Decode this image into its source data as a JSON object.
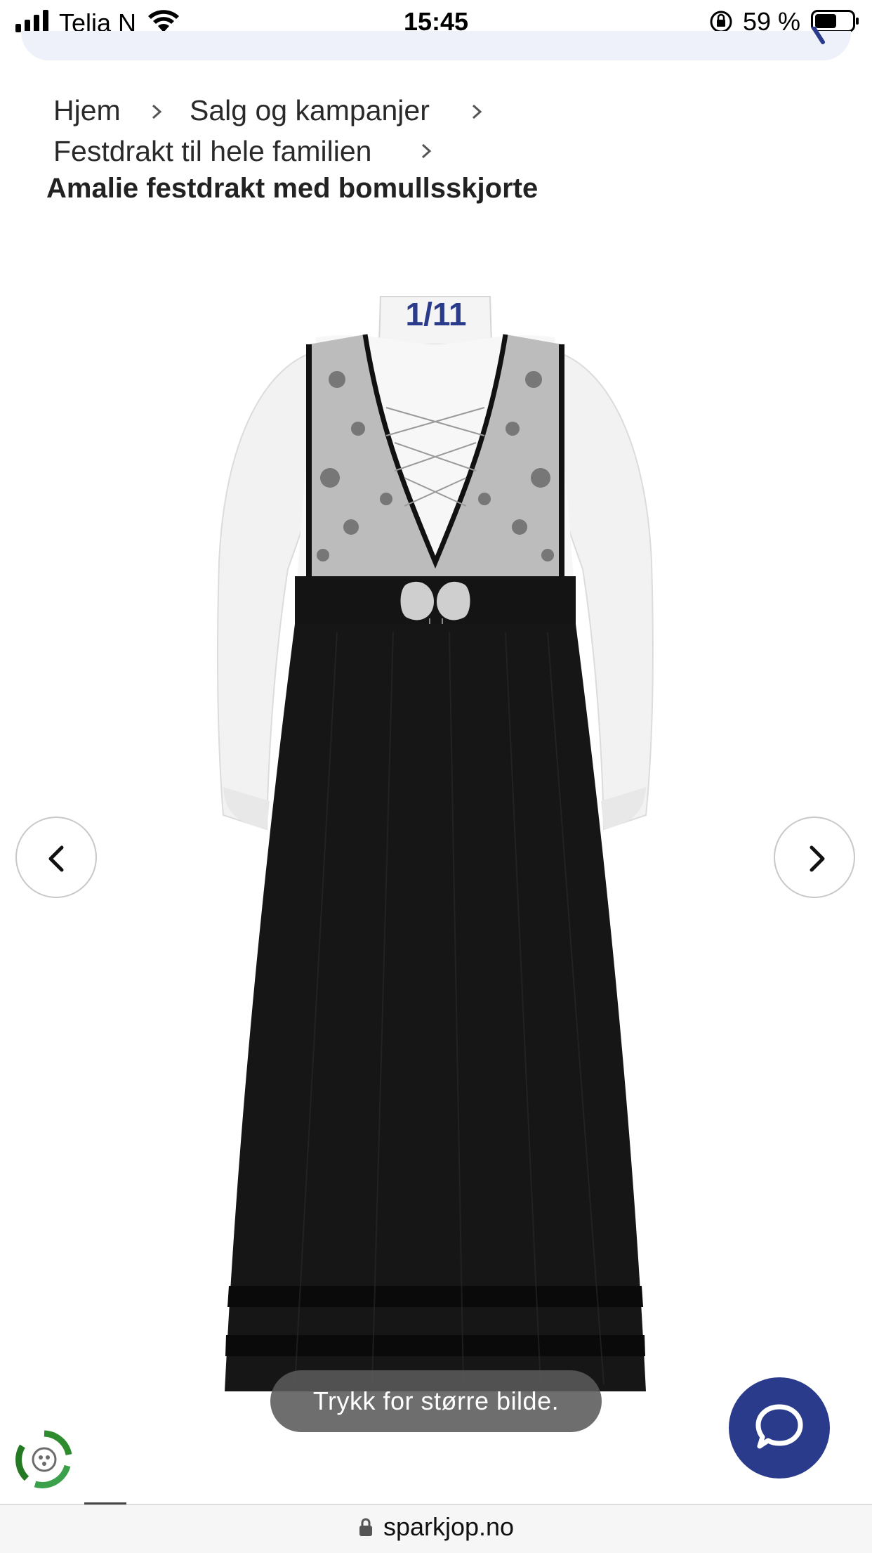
{
  "status_bar": {
    "carrier": "Telia N",
    "time": "15:45",
    "battery_percent": "59 %",
    "battery_level": 0.59
  },
  "breadcrumb": {
    "items": [
      "Hjem",
      "Salg og kampanjer",
      "Festdrakt til hele familien"
    ],
    "current": "Amalie festdrakt med bomullsskjorte"
  },
  "gallery": {
    "counter": "1/11",
    "hint": "Trykk for større bilde."
  },
  "browser": {
    "url": "sparkjop.no"
  },
  "colors": {
    "brand": "#2b3b8c",
    "toast_bg": "#5a5a5a"
  },
  "icons": [
    "signal-icon",
    "wifi-icon",
    "rotation-lock-icon",
    "battery-icon",
    "search-icon",
    "chevron-right-icon",
    "chevron-left-icon",
    "chat-icon",
    "eco-badge-icon",
    "lock-icon"
  ]
}
